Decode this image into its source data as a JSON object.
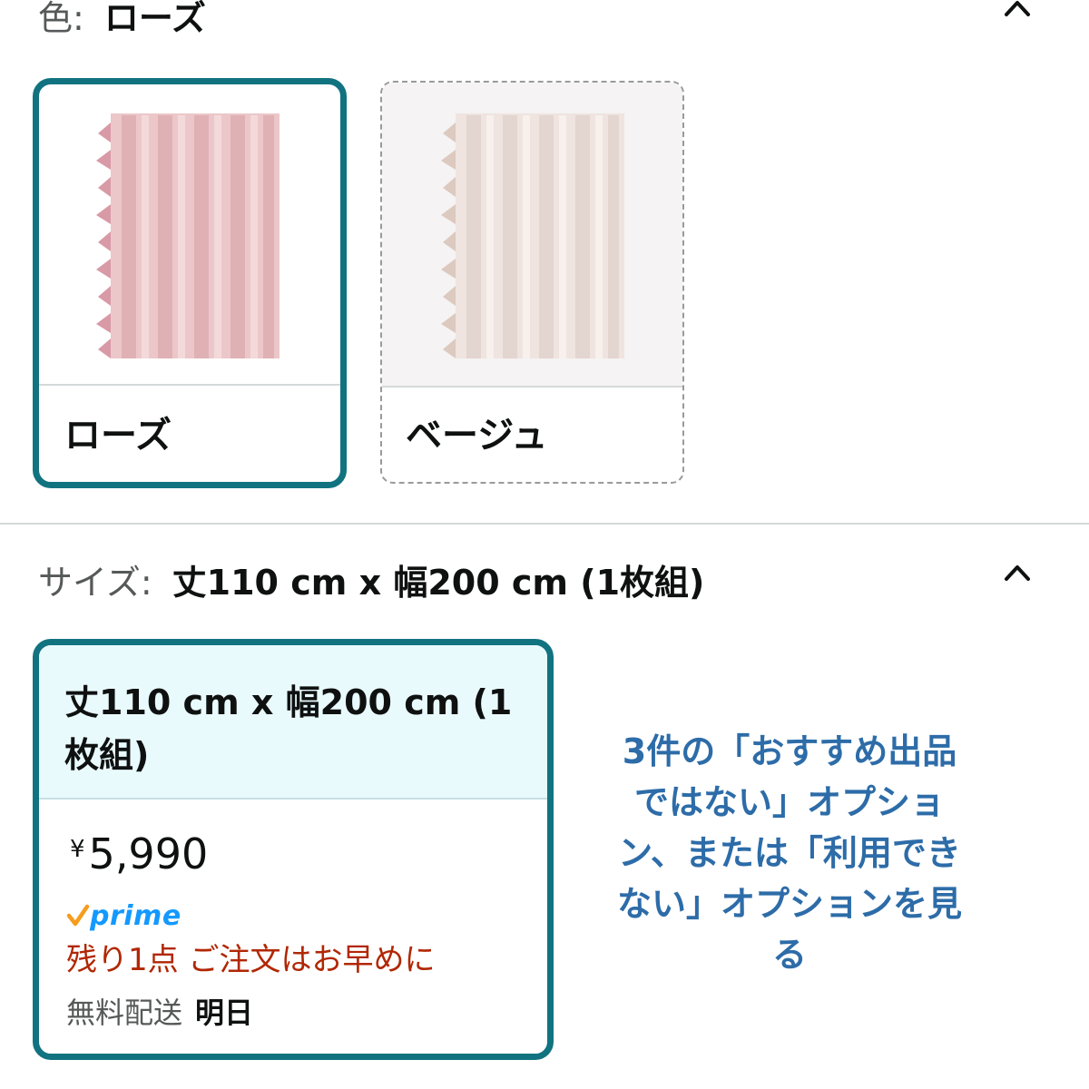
{
  "color_section": {
    "label": "色:",
    "selected_value": "ローズ",
    "options": [
      {
        "name": "ローズ",
        "selected": true
      },
      {
        "name": "ベージュ",
        "selected": false
      }
    ]
  },
  "size_section": {
    "label": "サイズ:",
    "selected_value": "丈110 cm x 幅200 cm (1枚組)",
    "card": {
      "title": "丈110 cm x 幅200 cm (1枚組)",
      "currency": "¥",
      "price": "5,990",
      "prime_label": "prime",
      "stock_message": "残り1点 ご注文はお早めに",
      "delivery_label": "無料配送",
      "delivery_date": "明日"
    },
    "more_options_link": "3件の「おすすめ出品ではない」オプション、または「利用できない」オプションを見る"
  },
  "colors": {
    "accent": "#127380",
    "link": "#2d6ca8",
    "stock_red": "#b12704",
    "prime_blue": "#1399ff",
    "prime_check": "#f79c1c"
  },
  "icons": {
    "collapse": "chevron-up-icon",
    "prime_check": "checkmark-icon"
  }
}
